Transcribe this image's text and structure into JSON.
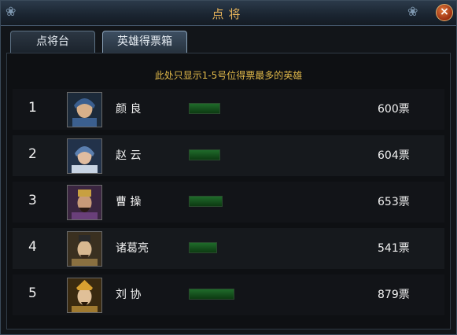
{
  "window": {
    "title": "点将"
  },
  "tabs": [
    {
      "label": "点将台",
      "active": false
    },
    {
      "label": "英雄得票箱",
      "active": true
    }
  ],
  "note": "此处只显示1-5号位得票最多的英雄",
  "max_votes_scale": 879,
  "colors": {
    "title": "#e6b35a",
    "note": "#e0b84a",
    "bar": "#1f6b2a"
  },
  "heroes": [
    {
      "rank": "1",
      "name": "颜 良",
      "votes": "600票",
      "vote_count": 600,
      "avatar_color": "#3b5f8f"
    },
    {
      "rank": "2",
      "name": "赵 云",
      "votes": "604票",
      "vote_count": 604,
      "avatar_color": "#5b7fb0"
    },
    {
      "rank": "3",
      "name": "曹 操",
      "votes": "653票",
      "vote_count": 653,
      "avatar_color": "#6a3f7a"
    },
    {
      "rank": "4",
      "name": "诸葛亮",
      "votes": "541票",
      "vote_count": 541,
      "avatar_color": "#8a7040"
    },
    {
      "rank": "5",
      "name": "刘 协",
      "votes": "879票",
      "vote_count": 879,
      "avatar_color": "#a07a30"
    }
  ]
}
